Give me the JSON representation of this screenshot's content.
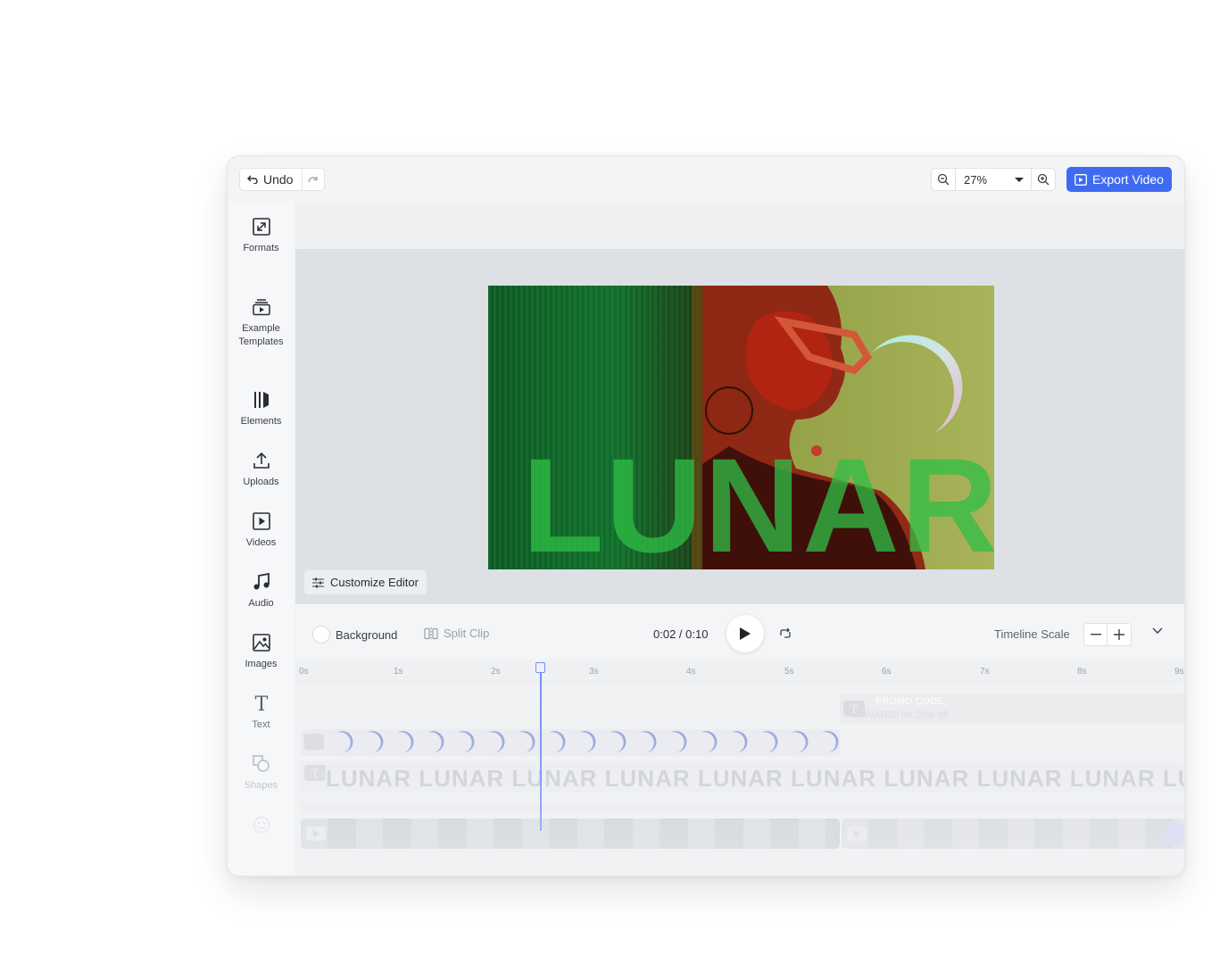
{
  "toolbar": {
    "undo_label": "Undo",
    "zoom_value": "27%",
    "export_label": "Export Video"
  },
  "sidebar": {
    "items": [
      {
        "label": "Formats",
        "icon": "formats-icon"
      },
      {
        "label": "Example Templates",
        "icon": "templates-icon"
      },
      {
        "label": "Elements",
        "icon": "elements-icon"
      },
      {
        "label": "Uploads",
        "icon": "upload-icon"
      },
      {
        "label": "Videos",
        "icon": "video-icon"
      },
      {
        "label": "Audio",
        "icon": "music-icon"
      },
      {
        "label": "Images",
        "icon": "image-icon"
      },
      {
        "label": "Text",
        "icon": "text-icon"
      },
      {
        "label": "Shapes",
        "icon": "shapes-icon"
      }
    ]
  },
  "canvas": {
    "headline": "LUNAR"
  },
  "editor": {
    "customize_label": "Customize Editor"
  },
  "controls": {
    "background_label": "Background",
    "split_label": "Split Clip",
    "time": "0:02 / 0:10",
    "scale_label": "Timeline Scale"
  },
  "timeline": {
    "ticks": [
      "0s",
      "1s",
      "2s",
      "3s",
      "4s",
      "5s",
      "6s",
      "7s",
      "8s",
      "9s"
    ],
    "text_clip_title": "PROMO CODE",
    "text_clip_sub": "LUNAR20 for 20% off",
    "lunar_track_text": "LUNAR LUNAR LUNAR LUNAR LUNAR LUNAR LUNAR LUNAR LUNAR LUNAR LUNAR"
  },
  "colors": {
    "accent": "#3f6bf0",
    "playhead": "#6f8ff5"
  }
}
